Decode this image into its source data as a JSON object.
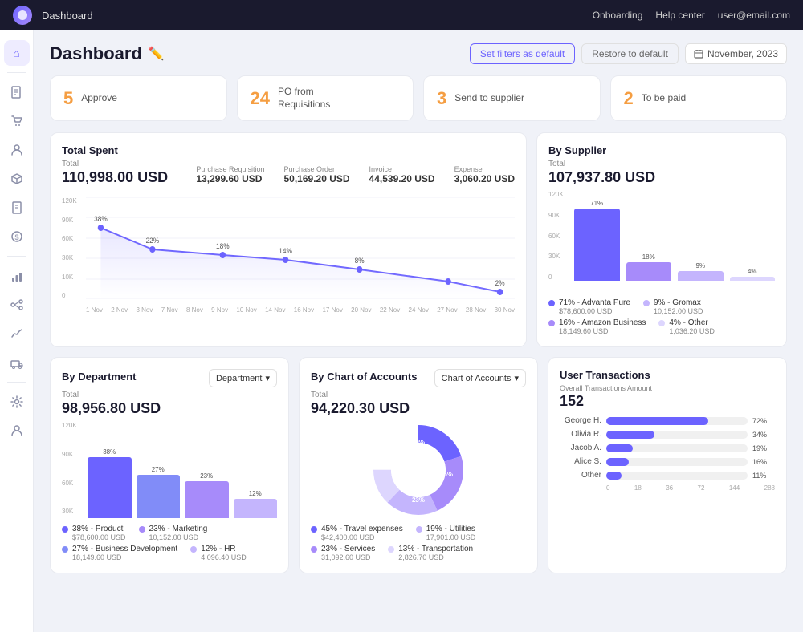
{
  "topnav": {
    "title": "Dashboard",
    "onboarding": "Onboarding",
    "help": "Help center",
    "user": "user@email.com"
  },
  "header": {
    "title": "Dashboard",
    "set_filters": "Set filters as default",
    "restore": "Restore to default",
    "date": "November, 2023"
  },
  "action_cards": [
    {
      "num": "5",
      "label": "Approve",
      "color": "orange"
    },
    {
      "num": "24",
      "label": "PO from\nRequisitions",
      "color": "orange"
    },
    {
      "num": "3",
      "label": "Send to supplier",
      "color": "orange"
    },
    {
      "num": "2",
      "label": "To be paid",
      "color": "orange"
    }
  ],
  "total_spent": {
    "title": "Total Spent",
    "total_label": "Total",
    "total_val": "110,998.00 USD",
    "metrics": [
      {
        "label": "Purchase Requisition",
        "val": "13,299.60 USD"
      },
      {
        "label": "Purchase Order",
        "val": "50,169.20 USD"
      },
      {
        "label": "Invoice",
        "val": "44,539.20 USD"
      },
      {
        "label": "Expense",
        "val": "3,060.20 USD"
      }
    ],
    "y_labels": [
      "120K",
      "90K",
      "60K",
      "30K",
      "10K",
      "0"
    ],
    "x_labels": [
      "1 Nov",
      "2 Nov",
      "3 Nov",
      "7 Nov",
      "8 Nov",
      "9 Nov",
      "10 Nov",
      "14 Nov",
      "16 Nov",
      "17 Nov",
      "20 Nov",
      "21 Nov",
      "22 Nov",
      "24 Nov",
      "27 Nov",
      "28 Nov",
      "30 Nov"
    ],
    "data_points": [
      {
        "x": 0,
        "y": 38,
        "pct": "38%"
      },
      {
        "x": 5,
        "y": 22,
        "pct": "22%"
      },
      {
        "x": 9,
        "y": 18,
        "pct": "18%"
      },
      {
        "x": 12,
        "y": 14,
        "pct": "14%"
      },
      {
        "x": 14,
        "y": 8,
        "pct": "8%"
      },
      {
        "x": 16,
        "y": 2,
        "pct": "2%"
      }
    ]
  },
  "by_supplier": {
    "title": "By Supplier",
    "total_label": "Total",
    "total_val": "107,937.80 USD",
    "y_labels": [
      "120K",
      "90K",
      "60K",
      "30K",
      "0"
    ],
    "bars": [
      {
        "pct": 71,
        "label": "71%",
        "color": "#6c63ff"
      },
      {
        "pct": 18,
        "label": "18%",
        "color": "#a78bfa"
      },
      {
        "pct": 9,
        "label": "9%",
        "color": "#c4b5fd"
      },
      {
        "pct": 4,
        "label": "4%",
        "color": "#ddd6fe"
      }
    ],
    "legend": [
      {
        "color": "#6c63ff",
        "name": "71% - Advanta Pure",
        "val": "$78,600.00 USD"
      },
      {
        "color": "#c4b5fd",
        "name": "9% - Gromax",
        "val": "10,152.00 USD"
      },
      {
        "color": "#a78bfa",
        "name": "16% - Amazon Business",
        "val": "18,149.60 USD"
      },
      {
        "color": "#ddd6fe",
        "name": "4% - Other",
        "val": "1,036.20 USD"
      }
    ]
  },
  "by_department": {
    "title": "By Department",
    "dropdown": "Department",
    "total_label": "Total",
    "total_val": "98,956.80 USD",
    "y_labels": [
      "120K",
      "90K",
      "60K",
      "30K"
    ],
    "bars": [
      {
        "pct": 38,
        "label": "38%",
        "color": "#6c63ff"
      },
      {
        "pct": 27,
        "label": "27%",
        "color": "#818cf8"
      },
      {
        "pct": 23,
        "label": "23%",
        "color": "#a78bfa"
      },
      {
        "pct": 12,
        "label": "12%",
        "color": "#c4b5fd"
      }
    ],
    "legend": [
      {
        "color": "#6c63ff",
        "name": "38% - Product",
        "val": "$78,600.00 USD"
      },
      {
        "color": "#a78bfa",
        "name": "23% - Marketing",
        "val": "10,152.00 USD"
      },
      {
        "color": "#818cf8",
        "name": "27% - Business Development",
        "val": "18,149.60 USD"
      },
      {
        "color": "#c4b5fd",
        "name": "12% - HR",
        "val": "4,096.40 USD"
      }
    ]
  },
  "by_chart_of_accounts": {
    "title": "By Chart of Accounts",
    "dropdown": "Chart of Accounts",
    "total_label": "Total",
    "total_val": "94,220.30 USD",
    "donut": [
      {
        "pct": 45,
        "color": "#6c63ff",
        "label": "45%"
      },
      {
        "pct": 23,
        "color": "#a78bfa",
        "label": "23%"
      },
      {
        "pct": 19,
        "color": "#c4b5fd",
        "label": "19%"
      },
      {
        "pct": 13,
        "color": "#ddd6fe",
        "label": "13%"
      }
    ],
    "legend": [
      {
        "color": "#6c63ff",
        "name": "45% - Travel expenses",
        "val": "$42,400.00 USD"
      },
      {
        "color": "#c4b5fd",
        "name": "19% - Utilities",
        "val": "17,901.00 USD"
      },
      {
        "color": "#a78bfa",
        "name": "23% - Services",
        "val": "31,092.60 USD"
      },
      {
        "color": "#ddd6fe",
        "name": "13% - Transportation",
        "val": "2,826.70 USD"
      }
    ]
  },
  "user_transactions": {
    "title": "User Transactions",
    "overall_label": "Overall Transactions Amount",
    "overall_val": "152",
    "users": [
      {
        "name": "George H.",
        "pct": 72
      },
      {
        "name": "Olivia R.",
        "pct": 34
      },
      {
        "name": "Jacob A.",
        "pct": 19
      },
      {
        "name": "Alice S.",
        "pct": 16
      },
      {
        "name": "Other",
        "pct": 11
      }
    ],
    "x_axis": [
      "0",
      "18",
      "36",
      "72",
      "144",
      "288"
    ]
  },
  "sidebar": {
    "items": [
      {
        "icon": "⌂",
        "name": "home"
      },
      {
        "icon": "📋",
        "name": "requisitions"
      },
      {
        "icon": "🛒",
        "name": "purchase-orders"
      },
      {
        "icon": "👤",
        "name": "suppliers"
      },
      {
        "icon": "📦",
        "name": "inventory"
      },
      {
        "icon": "📄",
        "name": "invoices"
      },
      {
        "icon": "💰",
        "name": "expenses"
      },
      {
        "icon": "📊",
        "name": "reports"
      },
      {
        "icon": "🔄",
        "name": "workflows"
      },
      {
        "icon": "📈",
        "name": "analytics"
      },
      {
        "icon": "🚚",
        "name": "logistics"
      },
      {
        "icon": "⚙️",
        "name": "settings"
      },
      {
        "icon": "👤",
        "name": "profile"
      }
    ]
  }
}
